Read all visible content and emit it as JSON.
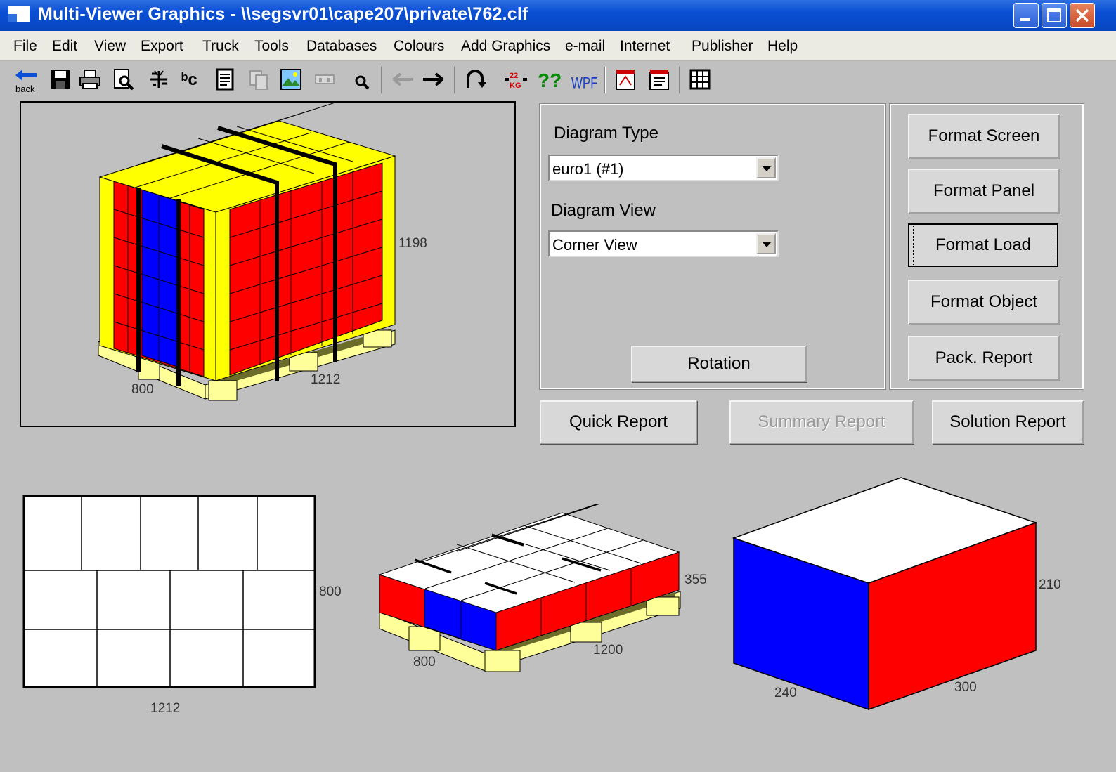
{
  "window": {
    "title": "Multi-Viewer Graphics - \\\\segsvr01\\cape207\\private\\762.clf"
  },
  "menu": [
    "File",
    "Edit",
    "View",
    "Export",
    "Truck",
    "Tools",
    "Databases",
    "Colours",
    "Add Graphics",
    "e-mail",
    "Internet",
    "Publisher",
    "Help"
  ],
  "toolbar": {
    "back_label": "back",
    "icons": [
      "back-icon",
      "save-icon",
      "print-icon",
      "print-preview-icon",
      "layers-icon",
      "text-label-icon",
      "report-icon",
      "copy-icon",
      "image-icon",
      "pallet-icon",
      "zoom-icon",
      "arrow-left-icon",
      "arrow-right-icon",
      "rotate-icon",
      "weight-icon",
      "help-icon",
      "wpf-icon",
      "pdf-icon",
      "pdf-report-icon",
      "grid-icon"
    ],
    "weight_text": "22 KG",
    "help_text": "??",
    "wpf_text": "WPF"
  },
  "controls": {
    "diagram_type_label": "Diagram Type",
    "diagram_type_value": "euro1 (#1)",
    "diagram_view_label": "Diagram View",
    "diagram_view_value": "Corner View",
    "rotation_button": "Rotation",
    "format_screen_button": "Format Screen",
    "format_panel_button": "Format Panel",
    "format_load_button": "Format Load",
    "format_object_button": "Format Object",
    "pack_report_button": "Pack. Report",
    "quick_report_button": "Quick Report",
    "summary_report_button": "Summary Report",
    "solution_report_button": "Solution Report"
  },
  "main_view": {
    "height": "1198",
    "depth": "800",
    "width": "1212"
  },
  "top_view": {
    "width": "1212",
    "depth": "800"
  },
  "layer_view": {
    "height": "355",
    "depth": "800",
    "width": "1200"
  },
  "case_view": {
    "height": "210",
    "depth": "240",
    "width": "300"
  },
  "colors": {
    "yellow": "#ffff00",
    "red": "#ff0000",
    "blue": "#0000ff",
    "pallet": "#ffff99",
    "title_blue": "#0a4fd4"
  }
}
